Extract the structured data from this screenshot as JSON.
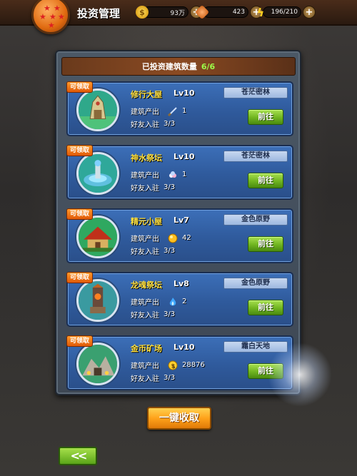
{
  "header": {
    "title": "投资管理",
    "resources": [
      {
        "icon": "coin-icon",
        "value": "93万"
      },
      {
        "icon": "crystal-icon",
        "value": "423"
      },
      {
        "icon": "lightning-icon",
        "value": "196/210"
      }
    ]
  },
  "panel": {
    "summary_label": "已投资建筑数量",
    "summary_count": "6/6",
    "badge_label": "可领取",
    "output_label": "建筑产出",
    "friends_label": "好友入驻",
    "go_label": "前往",
    "cards": [
      {
        "name": "修行大屋",
        "level": "Lv10",
        "region": "苍茫密林",
        "output_icon": "sword-icon",
        "output_value": "1",
        "friends": "3/3"
      },
      {
        "name": "神水祭坛",
        "level": "Lv10",
        "region": "苍茫密林",
        "output_icon": "gem-pile-icon",
        "output_value": "1",
        "friends": "3/3"
      },
      {
        "name": "精元小屋",
        "level": "Lv7",
        "region": "金色原野",
        "output_icon": "gold-orb-icon",
        "output_value": "42",
        "friends": "3/3"
      },
      {
        "name": "龙魂祭坛",
        "level": "Lv8",
        "region": "金色原野",
        "output_icon": "blue-flame-icon",
        "output_value": "2",
        "friends": "3/3"
      },
      {
        "name": "金币矿场",
        "level": "Lv10",
        "region": "霜白天地",
        "output_icon": "coin-icon",
        "output_value": "28876",
        "friends": "3/3"
      }
    ]
  },
  "footer": {
    "collect_all_label": "一键收取",
    "back_label": "<<"
  },
  "colors": {
    "accent_green": "#9cff4a",
    "card_blue": "#2f5a9c",
    "badge_orange": "#e05a08",
    "name_yellow": "#ffe040"
  }
}
